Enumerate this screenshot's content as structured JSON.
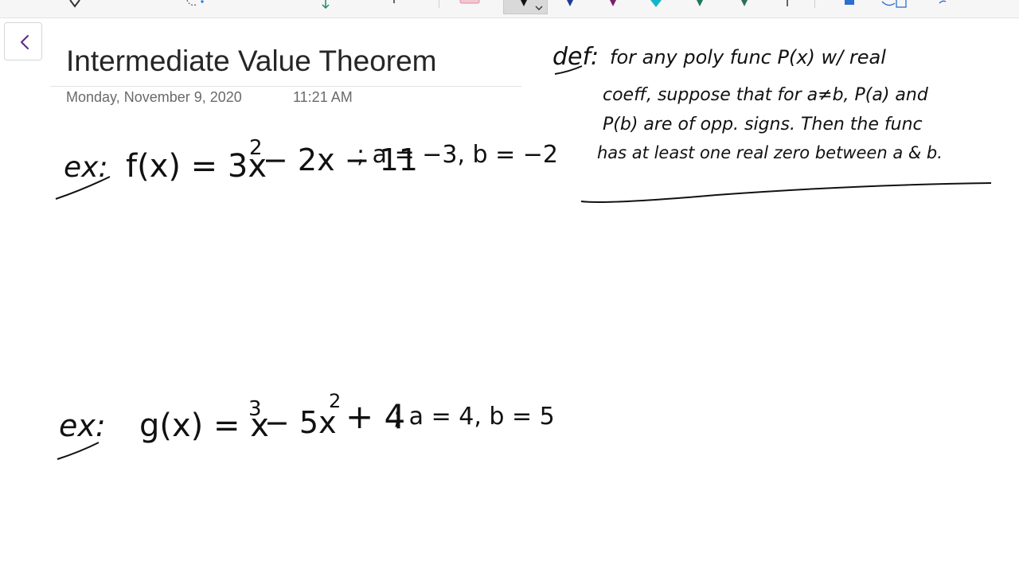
{
  "page": {
    "title": "Intermediate Value Theorem",
    "date": "Monday, November 9, 2020",
    "time": "11:21 AM"
  },
  "ink": {
    "definition": {
      "label": "def:",
      "lines": [
        "for any poly func P(x) w/ real",
        "coeff, suppose that for a≠b, P(a) and",
        "P(b) are of opp. signs. Then the func",
        "has at least one real zero between a & b."
      ]
    },
    "example1": {
      "label": "ex:",
      "function": "f(x) = 3x",
      "exp1": "2",
      "rest": "− 2x − 11",
      "interval": "; a = −3, b = −2"
    },
    "example2": {
      "label": "ex:",
      "function": "g(x) = x",
      "exp1": "3",
      "middle": "− 5x",
      "exp2": "2",
      "rest": "+ 4",
      "interval": "; a = 4, b = 5"
    }
  },
  "colors": {
    "pen_black": "#111111",
    "pen_blue": "#1f3a93",
    "pen_purple": "#7a1f6a",
    "pen_teal": "#12b5c9",
    "pen_green": "#1e7a5a",
    "accent_pink": "#e7a7b7"
  }
}
